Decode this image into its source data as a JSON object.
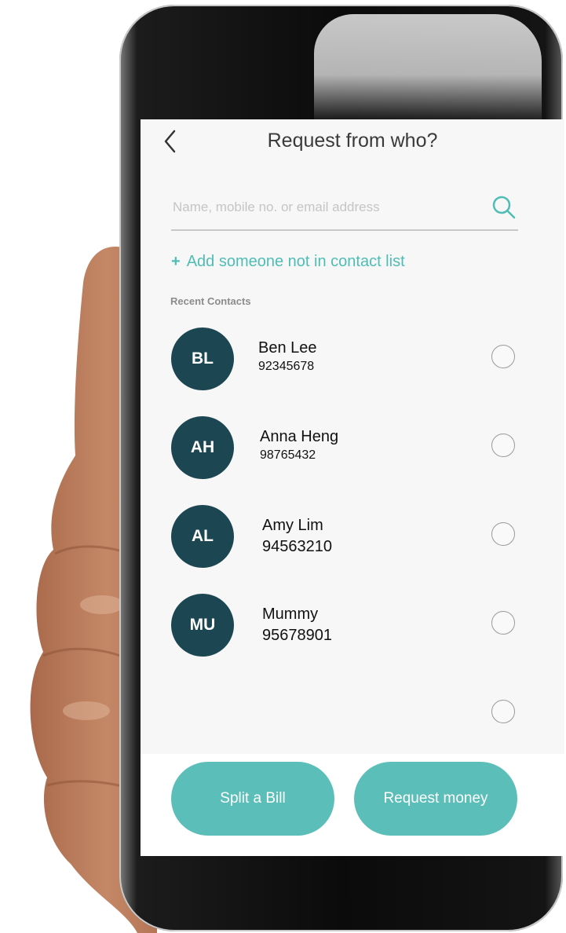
{
  "header": {
    "title": "Request from who?"
  },
  "search": {
    "placeholder": "Name, mobile no. or email address",
    "value": ""
  },
  "add_contact": {
    "label": "Add someone not in contact list"
  },
  "recent_contacts": {
    "label": "Recent Contacts",
    "items": [
      {
        "initials": "BL",
        "name": "Ben Lee",
        "phone": "92345678",
        "selected": false
      },
      {
        "initials": "AH",
        "name": "Anna Heng",
        "phone": "98765432",
        "selected": false
      },
      {
        "initials": "AL",
        "name": "Amy Lim",
        "phone": "94563210",
        "selected": false
      },
      {
        "initials": "MU",
        "name": "Mummy",
        "phone": "95678901",
        "selected": false
      }
    ]
  },
  "buttons": {
    "split_bill": "Split a Bill",
    "request_money": "Request money"
  },
  "colors": {
    "accent": "#4fbdb5",
    "button": "#5bbeb9",
    "avatar": "#1b4652"
  }
}
